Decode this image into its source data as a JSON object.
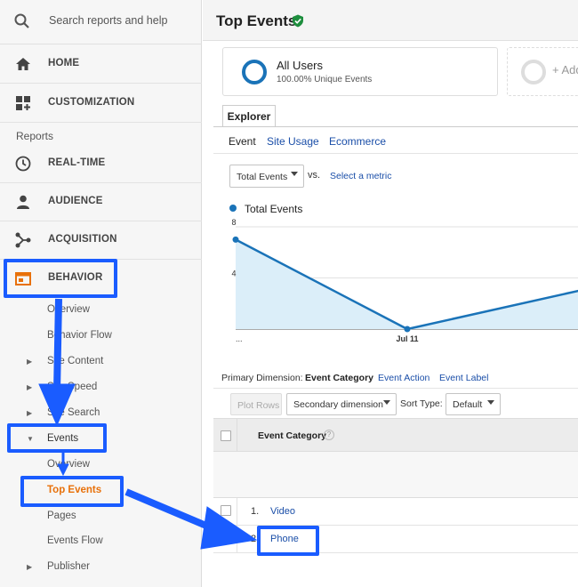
{
  "sidebar": {
    "search_placeholder": "Search reports and help",
    "nav": {
      "home": "HOME",
      "customization": "CUSTOMIZATION",
      "reports_section": "Reports",
      "realtime": "REAL-TIME",
      "audience": "AUDIENCE",
      "acquisition": "ACQUISITION",
      "behavior": "BEHAVIOR"
    },
    "behavior_items": {
      "overview": "Overview",
      "behavior_flow": "Behavior Flow",
      "site_content": "Site Content",
      "site_speed": "Site Speed",
      "site_search": "Site Search",
      "events": "Events",
      "events_overview": "Overview",
      "top_events": "Top Events",
      "pages": "Pages",
      "events_flow": "Events Flow",
      "publisher": "Publisher"
    }
  },
  "header": {
    "title": "Top Events"
  },
  "segment": {
    "name": "All Users",
    "detail": "100.00% Unique Events",
    "add_label": "+ Add"
  },
  "tabs": {
    "explorer": "Explorer"
  },
  "subtabs": {
    "event": "Event",
    "site_usage": "Site Usage",
    "ecommerce": "Ecommerce"
  },
  "metric": {
    "selected": "Total Events",
    "vs": "vs.",
    "select_metric": "Select a metric"
  },
  "chart_data": {
    "type": "line",
    "series": [
      {
        "name": "Total Events",
        "values": [
          7,
          0,
          3
        ]
      }
    ],
    "x": [
      "...",
      "Jul 11",
      ""
    ],
    "ytick_labels": [
      "8",
      "4"
    ],
    "ylim": [
      0,
      8
    ],
    "grid": true,
    "legend_position": "top-left",
    "color": "#1a73b8"
  },
  "dimension": {
    "primary_label": "Primary Dimension:",
    "event_category": "Event Category",
    "event_action": "Event Action",
    "event_label": "Event Label"
  },
  "controls": {
    "plot_rows": "Plot Rows",
    "secondary_dimension": "Secondary dimension",
    "sort_type_label": "Sort Type:",
    "sort_default": "Default"
  },
  "table": {
    "column_header": "Event Category",
    "help_glyph": "?",
    "rows": [
      {
        "index": "1.",
        "category": "Video"
      },
      {
        "index": "2.",
        "category": "Phone"
      }
    ]
  },
  "colors": {
    "highlight": "#1a5cff",
    "active_orange": "#e8710a",
    "link_blue": "#1a4ea8",
    "verified_green": "#1e8e3e"
  }
}
